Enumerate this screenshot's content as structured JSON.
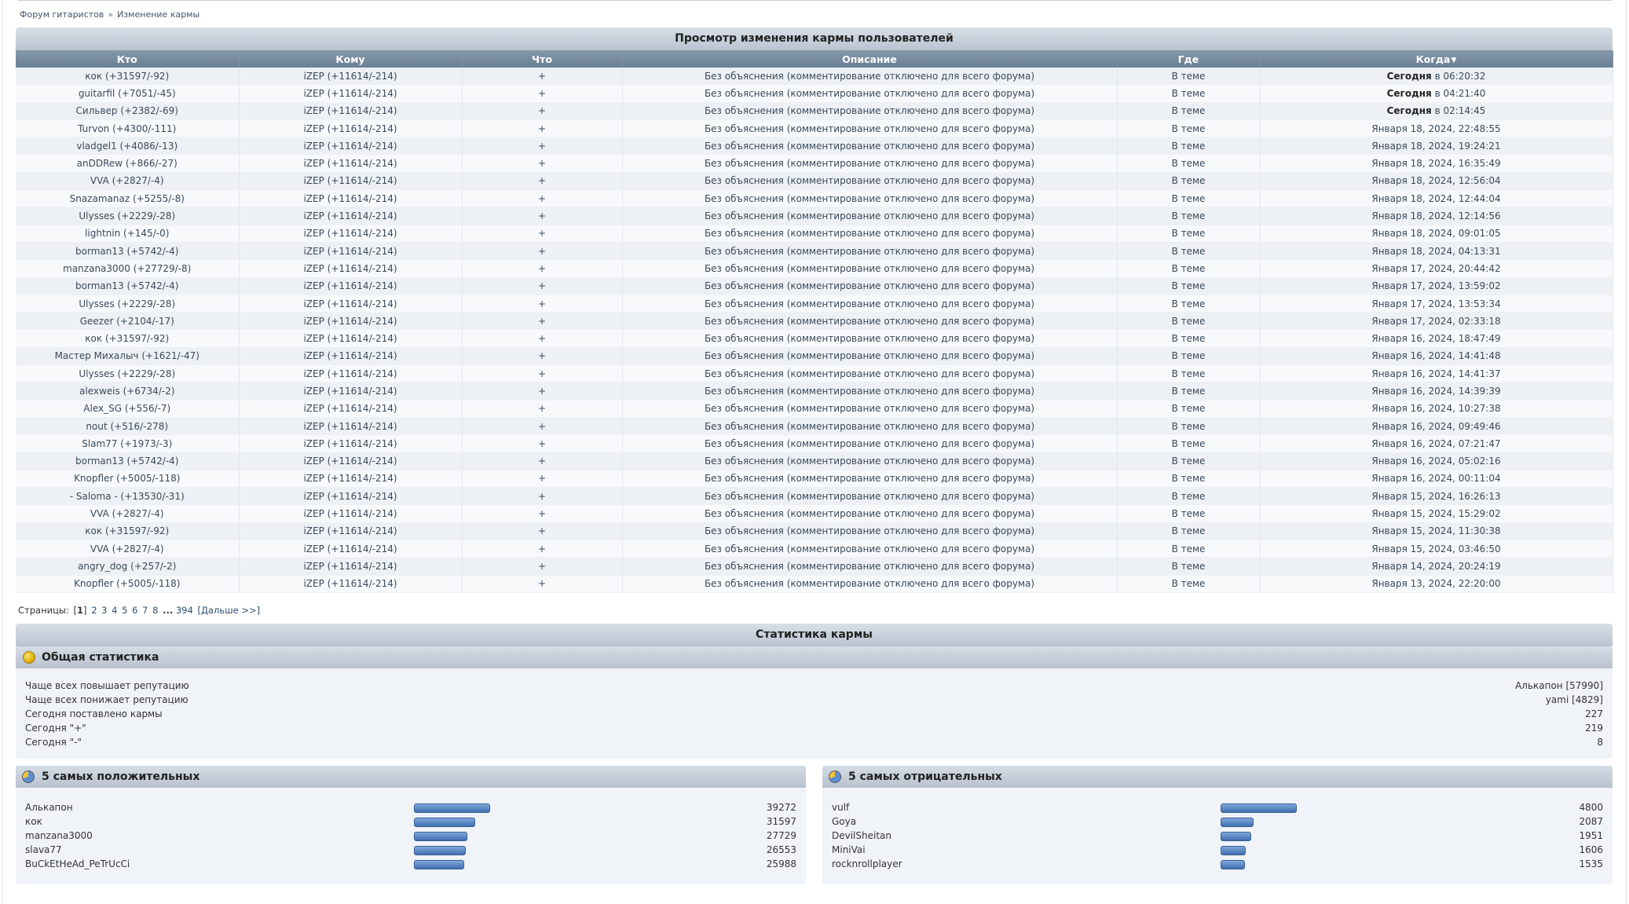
{
  "breadcrumb": {
    "forum": "Форум гитаристов",
    "separator": "»",
    "current": "Изменение кармы"
  },
  "log": {
    "title": "Просмотр изменения кармы пользователей",
    "columns": [
      "Кто",
      "Кому",
      "Что",
      "Описание",
      "Где",
      "Когда"
    ],
    "sort_arrow": "▼",
    "rows": [
      {
        "who": "кок (+31597/-92)",
        "to": "iZEP (+11614/-214)",
        "what": "+",
        "desc": "Без объяснения (комментирование отключено для всего форума)",
        "where": "В теме",
        "when_bold": "Сегодня",
        "when": " в 06:20:32"
      },
      {
        "who": "guitarfil (+7051/-45)",
        "to": "iZEP (+11614/-214)",
        "what": "+",
        "desc": "Без объяснения (комментирование отключено для всего форума)",
        "where": "В теме",
        "when_bold": "Сегодня",
        "when": " в 04:21:40"
      },
      {
        "who": "Сильвер (+2382/-69)",
        "to": "iZEP (+11614/-214)",
        "what": "+",
        "desc": "Без объяснения (комментирование отключено для всего форума)",
        "where": "В теме",
        "when_bold": "Сегодня",
        "when": " в 02:14:45"
      },
      {
        "who": "Turvon (+4300/-111)",
        "to": "iZEP (+11614/-214)",
        "what": "+",
        "desc": "Без объяснения (комментирование отключено для всего форума)",
        "where": "В теме",
        "when_bold": "",
        "when": "Января 18, 2024, 22:48:55"
      },
      {
        "who": "vladgel1 (+4086/-13)",
        "to": "iZEP (+11614/-214)",
        "what": "+",
        "desc": "Без объяснения (комментирование отключено для всего форума)",
        "where": "В теме",
        "when_bold": "",
        "when": "Января 18, 2024, 19:24:21"
      },
      {
        "who": "anDDRew (+866/-27)",
        "to": "iZEP (+11614/-214)",
        "what": "+",
        "desc": "Без объяснения (комментирование отключено для всего форума)",
        "where": "В теме",
        "when_bold": "",
        "when": "Января 18, 2024, 16:35:49"
      },
      {
        "who": "VVA (+2827/-4)",
        "to": "iZEP (+11614/-214)",
        "what": "+",
        "desc": "Без объяснения (комментирование отключено для всего форума)",
        "where": "В теме",
        "when_bold": "",
        "when": "Января 18, 2024, 12:56:04"
      },
      {
        "who": "Snazamanaz (+5255/-8)",
        "to": "iZEP (+11614/-214)",
        "what": "+",
        "desc": "Без объяснения (комментирование отключено для всего форума)",
        "where": "В теме",
        "when_bold": "",
        "when": "Января 18, 2024, 12:44:04"
      },
      {
        "who": "Ulysses (+2229/-28)",
        "to": "iZEP (+11614/-214)",
        "what": "+",
        "desc": "Без объяснения (комментирование отключено для всего форума)",
        "where": "В теме",
        "when_bold": "",
        "when": "Января 18, 2024, 12:14:56"
      },
      {
        "who": "lightnin (+145/-0)",
        "to": "iZEP (+11614/-214)",
        "what": "+",
        "desc": "Без объяснения (комментирование отключено для всего форума)",
        "where": "В теме",
        "when_bold": "",
        "when": "Января 18, 2024, 09:01:05"
      },
      {
        "who": "borman13 (+5742/-4)",
        "to": "iZEP (+11614/-214)",
        "what": "+",
        "desc": "Без объяснения (комментирование отключено для всего форума)",
        "where": "В теме",
        "when_bold": "",
        "when": "Января 18, 2024, 04:13:31"
      },
      {
        "who": "manzana3000 (+27729/-8)",
        "to": "iZEP (+11614/-214)",
        "what": "+",
        "desc": "Без объяснения (комментирование отключено для всего форума)",
        "where": "В теме",
        "when_bold": "",
        "when": "Января 17, 2024, 20:44:42"
      },
      {
        "who": "borman13 (+5742/-4)",
        "to": "iZEP (+11614/-214)",
        "what": "+",
        "desc": "Без объяснения (комментирование отключено для всего форума)",
        "where": "В теме",
        "when_bold": "",
        "when": "Января 17, 2024, 13:59:02"
      },
      {
        "who": "Ulysses (+2229/-28)",
        "to": "iZEP (+11614/-214)",
        "what": "+",
        "desc": "Без объяснения (комментирование отключено для всего форума)",
        "where": "В теме",
        "when_bold": "",
        "when": "Января 17, 2024, 13:53:34"
      },
      {
        "who": "Geezer (+2104/-17)",
        "to": "iZEP (+11614/-214)",
        "what": "+",
        "desc": "Без объяснения (комментирование отключено для всего форума)",
        "where": "В теме",
        "when_bold": "",
        "when": "Января 17, 2024, 02:33:18"
      },
      {
        "who": "кок (+31597/-92)",
        "to": "iZEP (+11614/-214)",
        "what": "+",
        "desc": "Без объяснения (комментирование отключено для всего форума)",
        "where": "В теме",
        "when_bold": "",
        "when": "Января 16, 2024, 18:47:49"
      },
      {
        "who": "Мастер Михалыч (+1621/-47)",
        "to": "iZEP (+11614/-214)",
        "what": "+",
        "desc": "Без объяснения (комментирование отключено для всего форума)",
        "where": "В теме",
        "when_bold": "",
        "when": "Января 16, 2024, 14:41:48"
      },
      {
        "who": "Ulysses (+2229/-28)",
        "to": "iZEP (+11614/-214)",
        "what": "+",
        "desc": "Без объяснения (комментирование отключено для всего форума)",
        "where": "В теме",
        "when_bold": "",
        "when": "Января 16, 2024, 14:41:37"
      },
      {
        "who": "alexweis (+6734/-2)",
        "to": "iZEP (+11614/-214)",
        "what": "+",
        "desc": "Без объяснения (комментирование отключено для всего форума)",
        "where": "В теме",
        "when_bold": "",
        "when": "Января 16, 2024, 14:39:39"
      },
      {
        "who": "Alex_SG (+556/-7)",
        "to": "iZEP (+11614/-214)",
        "what": "+",
        "desc": "Без объяснения (комментирование отключено для всего форума)",
        "where": "В теме",
        "when_bold": "",
        "when": "Января 16, 2024, 10:27:38"
      },
      {
        "who": "nout (+516/-278)",
        "to": "iZEP (+11614/-214)",
        "what": "+",
        "desc": "Без объяснения (комментирование отключено для всего форума)",
        "where": "В теме",
        "when_bold": "",
        "when": "Января 16, 2024, 09:49:46"
      },
      {
        "who": "Slam77 (+1973/-3)",
        "to": "iZEP (+11614/-214)",
        "what": "+",
        "desc": "Без объяснения (комментирование отключено для всего форума)",
        "where": "В теме",
        "when_bold": "",
        "when": "Января 16, 2024, 07:21:47"
      },
      {
        "who": "borman13 (+5742/-4)",
        "to": "iZEP (+11614/-214)",
        "what": "+",
        "desc": "Без объяснения (комментирование отключено для всего форума)",
        "where": "В теме",
        "when_bold": "",
        "when": "Января 16, 2024, 05:02:16"
      },
      {
        "who": "Knopfler (+5005/-118)",
        "to": "iZEP (+11614/-214)",
        "what": "+",
        "desc": "Без объяснения (комментирование отключено для всего форума)",
        "where": "В теме",
        "when_bold": "",
        "when": "Января 16, 2024, 00:11:04"
      },
      {
        "who": "- Saloma - (+13530/-31)",
        "to": "iZEP (+11614/-214)",
        "what": "+",
        "desc": "Без объяснения (комментирование отключено для всего форума)",
        "where": "В теме",
        "when_bold": "",
        "when": "Января 15, 2024, 16:26:13"
      },
      {
        "who": "VVA (+2827/-4)",
        "to": "iZEP (+11614/-214)",
        "what": "+",
        "desc": "Без объяснения (комментирование отключено для всего форума)",
        "where": "В теме",
        "when_bold": "",
        "when": "Января 15, 2024, 15:29:02"
      },
      {
        "who": "кок (+31597/-92)",
        "to": "iZEP (+11614/-214)",
        "what": "+",
        "desc": "Без объяснения (комментирование отключено для всего форума)",
        "where": "В теме",
        "when_bold": "",
        "when": "Января 15, 2024, 11:30:38"
      },
      {
        "who": "VVA (+2827/-4)",
        "to": "iZEP (+11614/-214)",
        "what": "+",
        "desc": "Без объяснения (комментирование отключено для всего форума)",
        "where": "В теме",
        "when_bold": "",
        "when": "Января 15, 2024, 03:46:50"
      },
      {
        "who": "angry_dog (+257/-2)",
        "to": "iZEP (+11614/-214)",
        "what": "+",
        "desc": "Без объяснения (комментирование отключено для всего форума)",
        "where": "В теме",
        "when_bold": "",
        "when": "Января 14, 2024, 20:24:19"
      },
      {
        "who": "Knopfler (+5005/-118)",
        "to": "iZEP (+11614/-214)",
        "what": "+",
        "desc": "Без объяснения (комментирование отключено для всего форума)",
        "where": "В теме",
        "when_bold": "",
        "when": "Января 13, 2024, 22:20:00"
      }
    ]
  },
  "pagination": {
    "label": "Страницы:",
    "current": "1",
    "pages": [
      "2",
      "3",
      "4",
      "5",
      "6",
      "7",
      "8"
    ],
    "ellipsis": "...",
    "last": "394",
    "next": "[Дальше >>]"
  },
  "stats": {
    "title": "Статистика кармы",
    "general": {
      "title": "Общая статистика",
      "icon": "coin-icon",
      "rows": [
        {
          "label": "Чаще всех повышает репутацию",
          "value": "Алькапон [57990]"
        },
        {
          "label": "Чаще всех понижает репутацию",
          "value": "yami [4829]"
        },
        {
          "label": "Сегодня поставлено кармы",
          "value": "227"
        },
        {
          "label": "Сегодня \"+\"",
          "value": "219"
        },
        {
          "label": "Сегодня \"-\"",
          "value": "8"
        }
      ]
    },
    "top_positive": {
      "title": "5 самых положительных",
      "icon": "pie-chart-icon",
      "max": 39272,
      "rows": [
        {
          "name": "Алькапон",
          "value": 39272
        },
        {
          "name": "кок",
          "value": 31597
        },
        {
          "name": "manzana3000",
          "value": 27729
        },
        {
          "name": "slava77",
          "value": 26553
        },
        {
          "name": "BuCkEtHeAd_PeTrUcCi",
          "value": 25988
        }
      ]
    },
    "top_negative": {
      "title": "5 самых отрицательных",
      "icon": "pie-chart-icon",
      "max": 4800,
      "rows": [
        {
          "name": "vulf",
          "value": 4800
        },
        {
          "name": "Goya",
          "value": 2087
        },
        {
          "name": "DevilSheitan",
          "value": 1951
        },
        {
          "name": "MiniVai",
          "value": 1606
        },
        {
          "name": "rocknrollplayer",
          "value": 1535
        }
      ]
    }
  },
  "colors": {
    "header": "#6b7f93",
    "row_odd": "#edf1f5",
    "row_even": "#f7f9fb",
    "bar": "#3f6fb0"
  }
}
